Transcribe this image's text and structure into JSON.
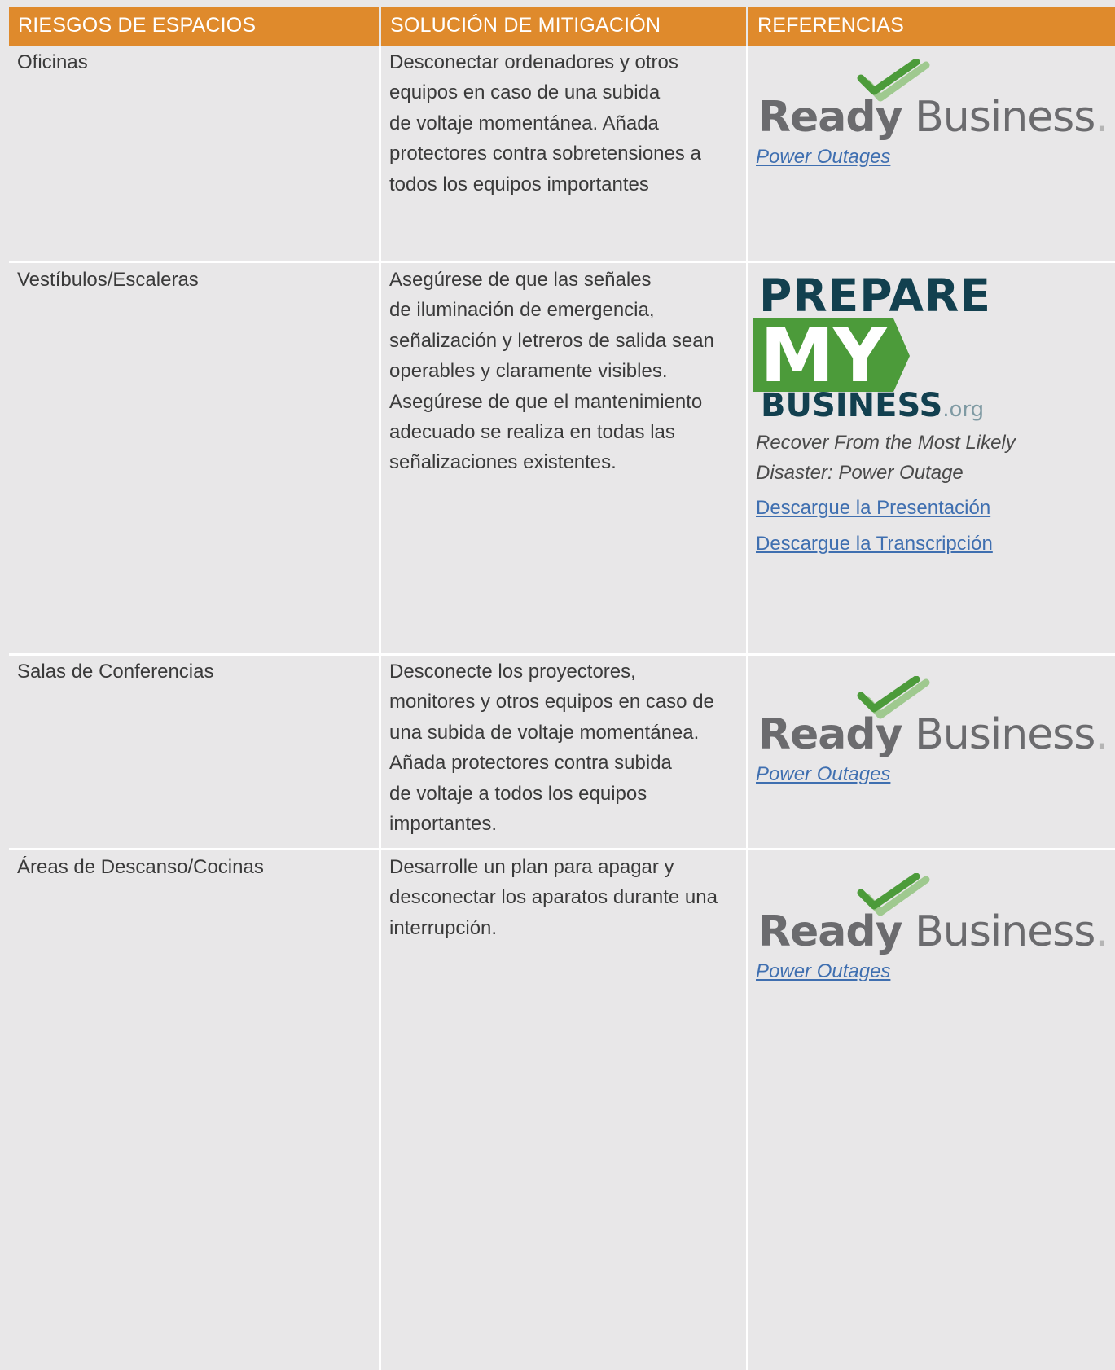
{
  "header": {
    "col1": "RIESGOS DE ESPACIOS",
    "col2": "SOLUCIÓN DE MITIGACIÓN",
    "col3": "REFERENCIAS"
  },
  "colors": {
    "header_bg": "#df8a2c",
    "page_bg": "#e8e7e8",
    "link": "#3f6fb0",
    "logo_green": "#4c9b3a",
    "logo_navy": "#12404f"
  },
  "rows": [
    {
      "risk": "Oficinas",
      "solution": [
        "Desconectar ordenadores y otros",
        "equipos en caso de una subida",
        "de voltaje momentánea. Añada",
        "protectores contra sobretensiones a",
        "todos los equipos importantes"
      ],
      "logo": "ready-business",
      "link": "Power Outages"
    },
    {
      "risk": "Vestíbulos/Escaleras",
      "solution": [
        "Asegúrese de que las señales",
        "de iluminación de emergencia,",
        "señalización y letreros de salida sean",
        "operables y claramente visibles.",
        "Asegúrese de que el mantenimiento",
        "adecuado se realiza en todas las",
        "señalizaciones existentes."
      ],
      "logo": "prepare-my-business",
      "description": [
        "Recover From the Most Likely",
        "Disaster: Power Outage"
      ],
      "links": [
        "Descargue la Presentación",
        "Descargue la Transcripción"
      ]
    },
    {
      "risk": "Salas de Conferencias",
      "solution": [
        "Desconecte los proyectores,",
        "monitores y otros equipos en caso de",
        "una subida de voltaje momentánea.",
        "Añada protectores contra subida",
        "de voltaje a todos los equipos",
        "importantes."
      ],
      "logo": "ready-business",
      "link": "Power Outages"
    },
    {
      "risk": "Áreas de Descanso/Cocinas",
      "solution": [
        "Desarrolle un plan para apagar y",
        "desconectar los aparatos durante una",
        "interrupción."
      ],
      "logo": "ready-business",
      "link": "Power Outages"
    }
  ],
  "logos": {
    "ready_business": {
      "word1": "Ready",
      "word2": "Business",
      "dot": "."
    },
    "prepare_my_business": {
      "line1": "PREPARE",
      "line2": "MY",
      "line3": "BUSINESS",
      "suffix": ".org"
    }
  }
}
